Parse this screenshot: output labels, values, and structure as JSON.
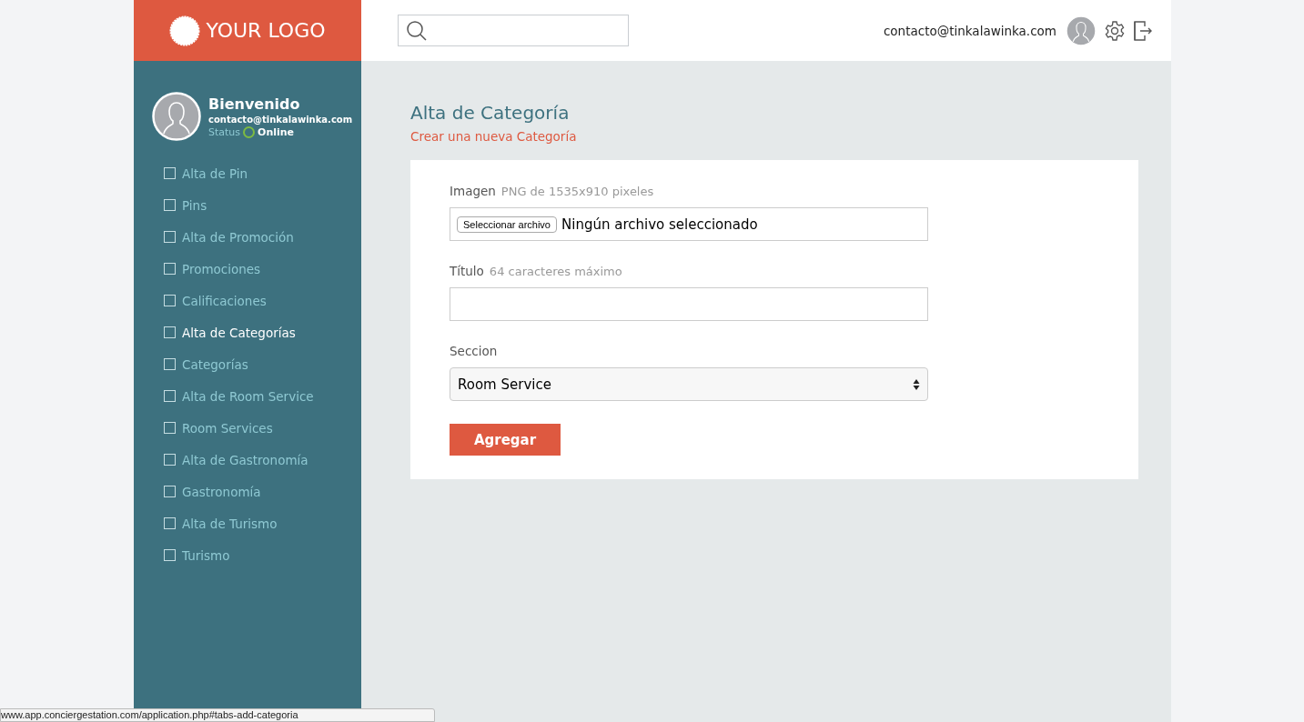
{
  "logo": {
    "text": "YOUR LOGO"
  },
  "header": {
    "email": "contacto@tinkalawinka.com"
  },
  "profile": {
    "greeting": "Bienvenido",
    "email": "contacto@tinkalawinka.com",
    "status_label": "Status",
    "status": "Online",
    "color": "#7dbb42"
  },
  "sidebar": {
    "items": [
      {
        "label": "Alta de Pin",
        "selected": false
      },
      {
        "label": "Pins",
        "selected": false
      },
      {
        "label": "Alta de Promoción",
        "selected": false
      },
      {
        "label": "Promociones",
        "selected": false
      },
      {
        "label": "Calificaciones",
        "selected": false
      },
      {
        "label": "Alta de Categorías",
        "selected": true
      },
      {
        "label": "Categorías",
        "selected": false
      },
      {
        "label": "Alta de Room Service",
        "selected": false
      },
      {
        "label": "Room Services",
        "selected": false
      },
      {
        "label": "Alta de Gastronomía",
        "selected": false
      },
      {
        "label": "Gastronomía",
        "selected": false
      },
      {
        "label": "Alta de Turismo",
        "selected": false
      },
      {
        "label": "Turismo",
        "selected": false
      }
    ]
  },
  "page": {
    "title": "Alta de Categoría",
    "subtitle": "Crear una nueva Categoría"
  },
  "form": {
    "fields": [
      {
        "kind": "file",
        "label": "Imagen",
        "hint": "PNG de 1535x910 pixeles",
        "button": "Seleccionar archivo",
        "value": "Ningún archivo seleccionado"
      },
      {
        "kind": "text",
        "label": "Título",
        "hint": "64 caracteres máximo"
      },
      {
        "kind": "select",
        "label": "Seccion",
        "value": "Room Service"
      }
    ],
    "submit": "Agregar"
  },
  "status_url": "www.app.conciergestation.com/application.php#tabs-add-categoria"
}
